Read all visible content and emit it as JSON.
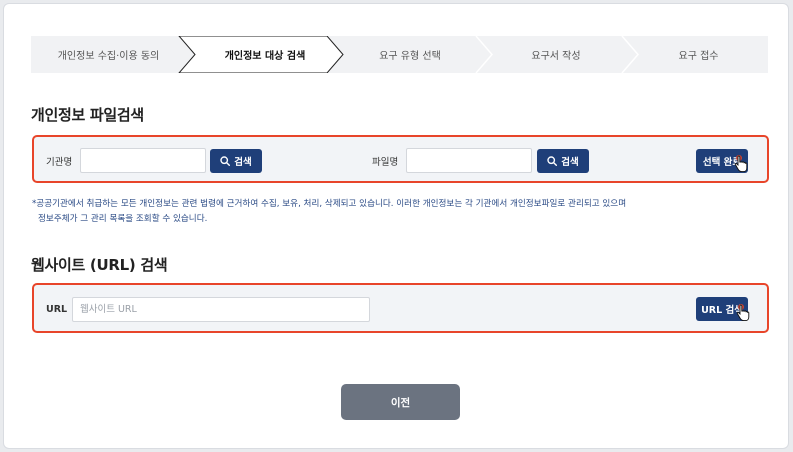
{
  "steps": [
    {
      "label": "개인정보 수집·이용 동의",
      "active": false
    },
    {
      "label": "개인정보 대상 검색",
      "active": true
    },
    {
      "label": "요구 유형 선택",
      "active": false
    },
    {
      "label": "요구서 작성",
      "active": false
    },
    {
      "label": "요구 접수",
      "active": false
    }
  ],
  "file_search": {
    "title": "개인정보 파일검색",
    "org_label": "기관명",
    "org_value": "",
    "org_search_label": "검색",
    "file_label": "파일명",
    "file_value": "",
    "file_search_label": "검색",
    "complete_label": "선택 완료"
  },
  "notice": {
    "line1": "*공공기관에서 취급하는 모든 개인정보는 관련 법령에 근거하여 수집, 보유, 처리, 삭제되고 있습니다. 이러한 개인정보는 각 기관에서 개인정보파일로 관리되고 있으며",
    "line2": "정보주체가 그 관리 목록을 조회할 수 있습니다."
  },
  "website_search": {
    "title": "웹사이트 (URL) 검색",
    "url_label": "URL",
    "url_placeholder": "웹사이트 URL",
    "url_value": "",
    "url_search_label": "URL 검색"
  },
  "footer": {
    "prev_label": "이전"
  },
  "colors": {
    "primary": "#1f3f79",
    "highlight_border": "#e8452a",
    "notice_text": "#2b4b86",
    "prev_button": "#6b7380"
  },
  "icons": [
    "search-icon",
    "hand-pointer-icon"
  ]
}
